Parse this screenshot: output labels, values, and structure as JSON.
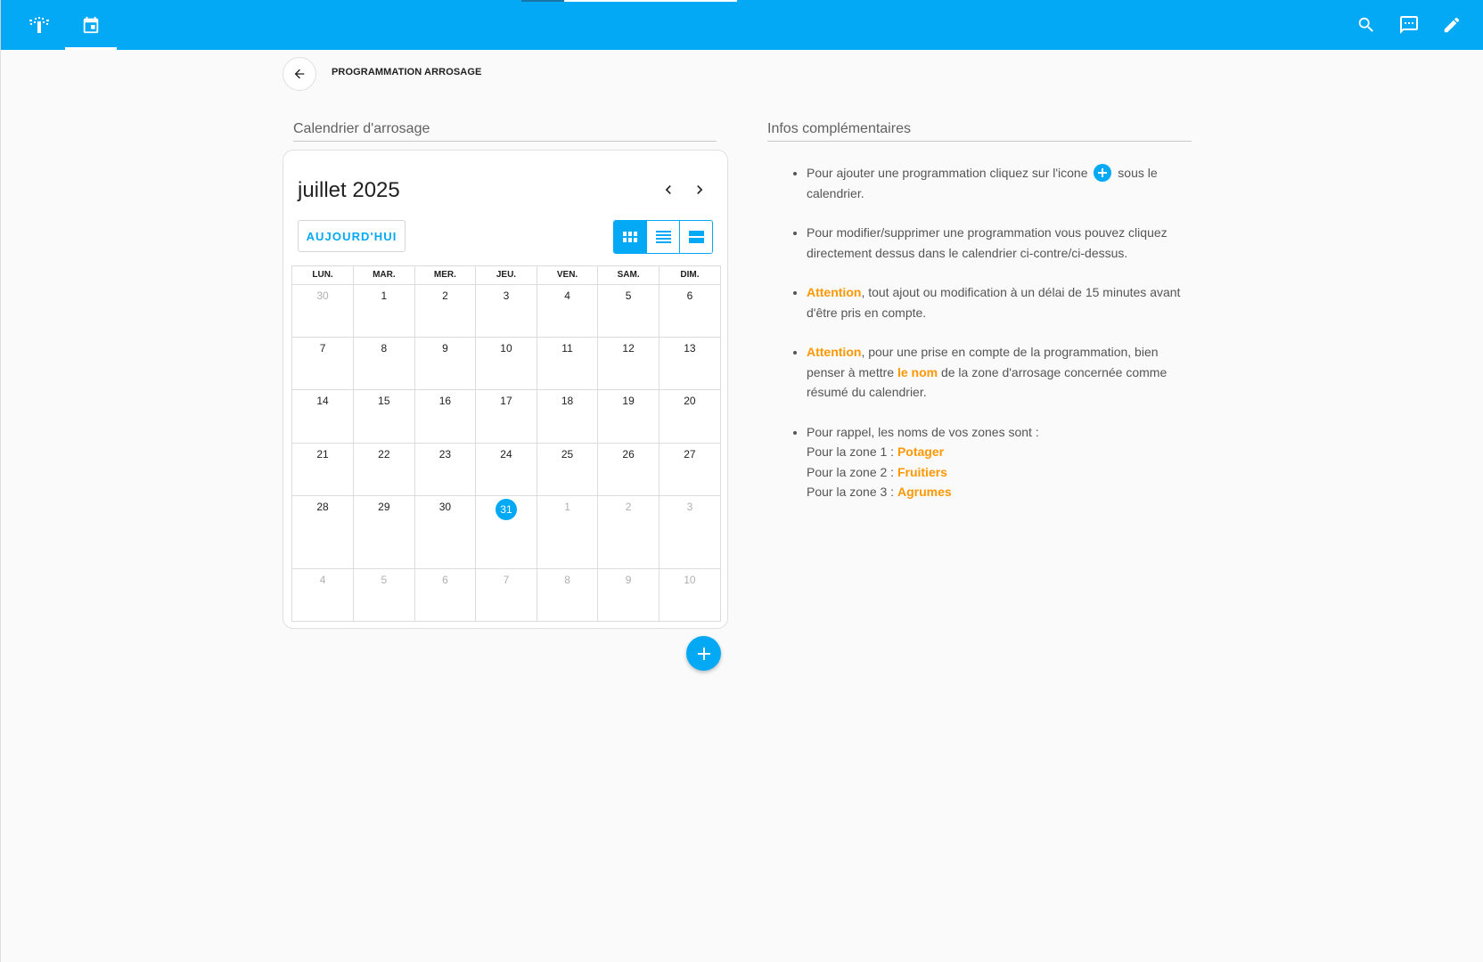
{
  "colors": {
    "primary": "#03a9f4",
    "highlight": "#ff9800",
    "app_bar": "#03a9f4"
  },
  "top_bar": {
    "tabs": [
      {
        "icon": "sprinkler-icon",
        "active": false
      },
      {
        "icon": "calendar-icon",
        "active": true
      }
    ],
    "actions": [
      "search-icon",
      "message-icon",
      "pencil-icon"
    ]
  },
  "header": {
    "back_icon": "arrow-left-icon",
    "title": "PROGRAMMATION ARROSAGE"
  },
  "calendar_section": {
    "title": "Calendrier d'arrosage",
    "month_label": "juillet 2025",
    "today_label": "AUJOURD'HUI",
    "views": [
      "grid-view-icon",
      "list-view-icon",
      "day-view-icon"
    ],
    "active_view": "grid-view-icon",
    "weekdays": [
      "LUN.",
      "MAR.",
      "MER.",
      "JEU.",
      "VEN.",
      "SAM.",
      "DIM."
    ],
    "weeks": [
      [
        {
          "d": "30",
          "other": true
        },
        {
          "d": "1"
        },
        {
          "d": "2"
        },
        {
          "d": "3"
        },
        {
          "d": "4"
        },
        {
          "d": "5"
        },
        {
          "d": "6"
        }
      ],
      [
        {
          "d": "7"
        },
        {
          "d": "8"
        },
        {
          "d": "9"
        },
        {
          "d": "10"
        },
        {
          "d": "11"
        },
        {
          "d": "12"
        },
        {
          "d": "13"
        }
      ],
      [
        {
          "d": "14"
        },
        {
          "d": "15"
        },
        {
          "d": "16"
        },
        {
          "d": "17"
        },
        {
          "d": "18"
        },
        {
          "d": "19"
        },
        {
          "d": "20"
        }
      ],
      [
        {
          "d": "21"
        },
        {
          "d": "22"
        },
        {
          "d": "23"
        },
        {
          "d": "24"
        },
        {
          "d": "25"
        },
        {
          "d": "26"
        },
        {
          "d": "27"
        }
      ],
      [
        {
          "d": "28"
        },
        {
          "d": "29"
        },
        {
          "d": "30"
        },
        {
          "d": "31",
          "today": true
        },
        {
          "d": "1",
          "other": true
        },
        {
          "d": "2",
          "other": true
        },
        {
          "d": "3",
          "other": true
        }
      ],
      [
        {
          "d": "4",
          "other": true
        },
        {
          "d": "5",
          "other": true
        },
        {
          "d": "6",
          "other": true
        },
        {
          "d": "7",
          "other": true
        },
        {
          "d": "8",
          "other": true
        },
        {
          "d": "9",
          "other": true
        },
        {
          "d": "10",
          "other": true
        }
      ]
    ],
    "add_button_icon": "plus-icon"
  },
  "info_section": {
    "title": "Infos complémentaires",
    "item1_before": "Pour ajouter une programmation cliquez sur l'icone",
    "item1_after": "sous le calendrier.",
    "item2": "Pour modifier/supprimer une programmation vous pouvez cliquez directement dessus dans le calendrier ci-contre/ci-dessus.",
    "item3_hl": "Attention",
    "item3_rest": ", tout ajout ou modification à un délai de 15 minutes avant d'être pris en compte.",
    "item4_hl": "Attention",
    "item4_mid": ", pour une prise en compte de la programmation, bien penser à mettre",
    "item4_hl2": "le nom",
    "item4_end": "de la zone d'arrosage concernée comme résumé du calendrier.",
    "item5_intro": "Pour rappel, les noms de vos zones sont :",
    "zones": [
      {
        "label": "Pour la zone 1 :",
        "name": "Potager"
      },
      {
        "label": "Pour la zone 2 :",
        "name": "Fruitiers"
      },
      {
        "label": "Pour la zone 3 :",
        "name": "Agrumes"
      }
    ]
  }
}
